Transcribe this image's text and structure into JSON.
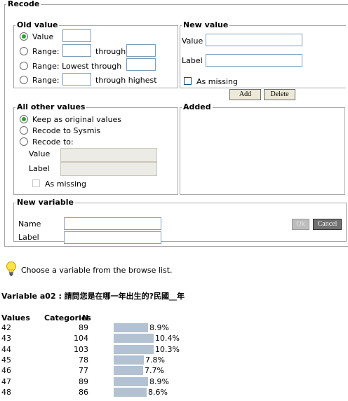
{
  "recode": {
    "legend": "Recode",
    "old_value": {
      "legend": "Old value",
      "value_label": "Value",
      "range_label": "Range:",
      "through_label": "through",
      "lowest_label": "Range: Lowest through",
      "highest_label": "through highest",
      "selected": "value"
    },
    "new_value": {
      "legend": "New value",
      "value_label": "Value",
      "label_label": "Label",
      "as_missing_label": "As missing",
      "add_button": "Add",
      "delete_button": "Delete"
    },
    "all_other": {
      "legend": "All other values",
      "keep_label": "Keep as original values",
      "sysmis_label": "Recode to Sysmis",
      "recode_to_label": "Recode to:",
      "value_label": "Value",
      "label_label": "Label",
      "as_missing_label": "As missing",
      "selected": "keep"
    },
    "added": {
      "legend": "Added"
    },
    "new_variable": {
      "legend": "New variable",
      "name_label": "Name",
      "label_label": "Label",
      "ok_button": "Ok",
      "cancel_button": "Cancel"
    }
  },
  "hint": {
    "icon": "lightbulb-icon",
    "text": "Choose a variable from the browse list."
  },
  "variable": {
    "title": "Variable a02 : 請問您是在哪一年出生的?民國__年",
    "headers": {
      "values": "Values",
      "categories": "Categories",
      "n": "N"
    }
  },
  "colors": {
    "bar": "#b3c2d2",
    "radio_selected": "#27a52a"
  },
  "chart_data": {
    "type": "table",
    "rows": [
      {
        "value": "42",
        "n": 89,
        "percent": 8.9,
        "label": "8.9%"
      },
      {
        "value": "43",
        "n": 104,
        "percent": 10.4,
        "label": "10.4%"
      },
      {
        "value": "44",
        "n": 103,
        "percent": 10.3,
        "label": "10.3%"
      },
      {
        "value": "45",
        "n": 78,
        "percent": 7.8,
        "label": "7.8%"
      },
      {
        "value": "46",
        "n": 77,
        "percent": 7.7,
        "label": "7.7%"
      },
      {
        "value": "47",
        "n": 89,
        "percent": 8.9,
        "label": "8.9%"
      },
      {
        "value": "48",
        "n": 86,
        "percent": 8.6,
        "label": "8.6%"
      }
    ]
  }
}
